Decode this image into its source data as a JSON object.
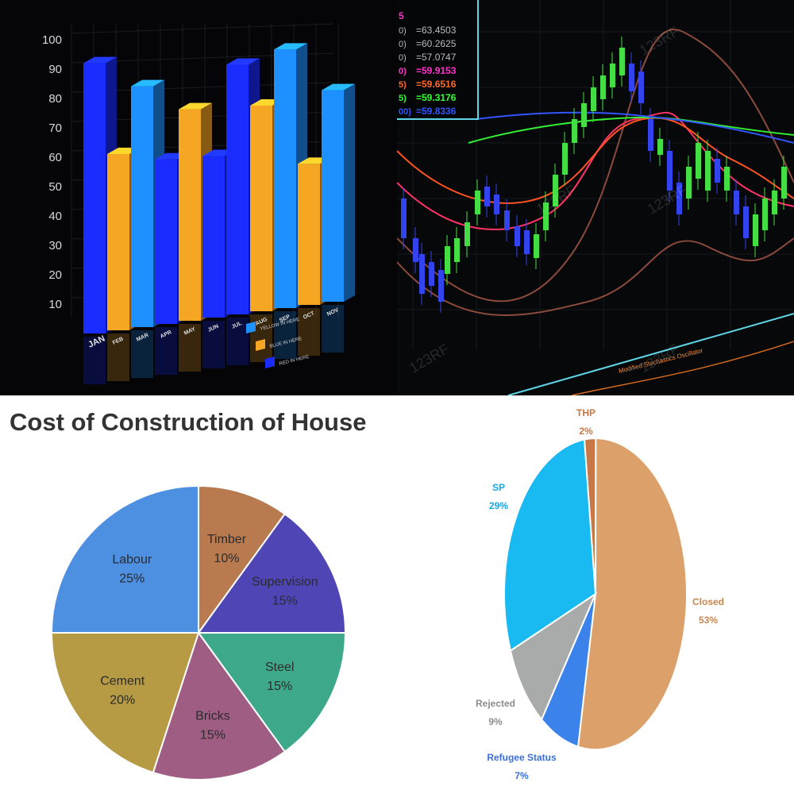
{
  "chart_data": [
    {
      "type": "bar",
      "title": "",
      "categories": [
        "JAN",
        "FEB",
        "MAR",
        "APR",
        "MAY",
        "JUN",
        "JUL",
        "AUG",
        "SEP",
        "OCT",
        "NOV"
      ],
      "ylim": [
        0,
        100
      ],
      "yticks": [
        10,
        20,
        30,
        40,
        50,
        60,
        70,
        80,
        90,
        100
      ],
      "grid": true,
      "legend_position": "bottom-right",
      "series": [
        {
          "name": "YELLOW IN HERE",
          "color": "#1e90ff",
          "values": [
            0,
            0,
            82,
            0,
            0,
            0,
            0,
            0,
            88,
            0,
            72
          ]
        },
        {
          "name": "BLUE IN HERE",
          "color": "#f5a623",
          "values": [
            0,
            60,
            0,
            0,
            72,
            0,
            0,
            70,
            0,
            48,
            0
          ]
        },
        {
          "name": "RED IN HERE",
          "color": "#1a2cff",
          "values": [
            92,
            0,
            0,
            56,
            0,
            55,
            85,
            0,
            0,
            0,
            0
          ]
        }
      ]
    },
    {
      "type": "line",
      "title": "",
      "grid": true,
      "legend_position": "top-left",
      "readouts": [
        {
          "label": "0)",
          "value": "=63.4503",
          "color": "#bbbbbb"
        },
        {
          "label": "0)",
          "value": "=60.2625",
          "color": "#bbbbbb"
        },
        {
          "label": "0)",
          "value": "=57.0747",
          "color": "#bbbbbb"
        },
        {
          "label": "0)",
          "value": "=59.9153",
          "color": "#ff33cc"
        },
        {
          "label": "5)",
          "value": "=59.6516",
          "color": "#ff6a2a"
        },
        {
          "label": "5)",
          "value": "=59.3176",
          "color": "#33ff33"
        },
        {
          "label": "00)",
          "value": "=59.8336",
          "color": "#3355ff"
        }
      ],
      "watermark": "123RF",
      "footer_text": "Modified Stochastics Oscillator"
    },
    {
      "type": "pie",
      "title": "Cost of Construction of House",
      "slices": [
        {
          "label": "Timber",
          "value": 10,
          "pct": "10%",
          "color": "#b97a50"
        },
        {
          "label": "Supervision",
          "value": 15,
          "pct": "15%",
          "color": "#4f45b5"
        },
        {
          "label": "Steel",
          "value": 15,
          "pct": "15%",
          "color": "#3ea98a"
        },
        {
          "label": "Bricks",
          "value": 15,
          "pct": "15%",
          "color": "#a05d84"
        },
        {
          "label": "Cement",
          "value": 20,
          "pct": "20%",
          "color": "#b69a44"
        },
        {
          "label": "Labour",
          "value": 25,
          "pct": "25%",
          "color": "#4d8fe0"
        }
      ]
    },
    {
      "type": "pie",
      "title": "",
      "slices": [
        {
          "label": "THP",
          "value": 2,
          "pct": "2%",
          "color": "#c87746",
          "text_color": "#c87746"
        },
        {
          "label": "Closed",
          "value": 53,
          "pct": "53%",
          "color": "#dca06a",
          "text_color": "#c8874e"
        },
        {
          "label": "Refugee Status",
          "value": 7,
          "pct": "7%",
          "color": "#3b82ea",
          "text_color": "#3b6fd8"
        },
        {
          "label": "Rejected",
          "value": 9,
          "pct": "9%",
          "color": "#a9aaaa",
          "text_color": "#8c8c8c"
        },
        {
          "label": "SP",
          "value": 29,
          "pct": "29%",
          "color": "#19b9f2",
          "text_color": "#19a8e8"
        }
      ]
    }
  ]
}
